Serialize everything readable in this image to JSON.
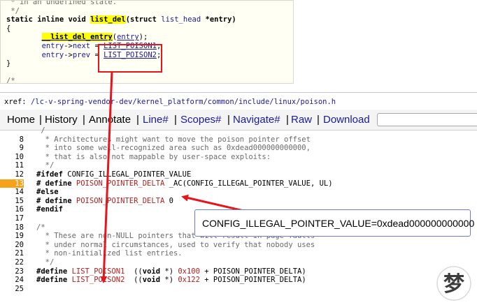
{
  "snippet": {
    "lines": [
      [
        {
          "c": "gr",
          "t": " * in an undefined state."
        }
      ],
      [
        {
          "c": "gr",
          "t": " */"
        }
      ],
      [
        {
          "c": "kw",
          "t": "static inline void "
        },
        {
          "c": "fn",
          "t": "list_del"
        },
        {
          "c": "kw",
          "t": "(struct "
        },
        {
          "c": "ty",
          "t": "list_head"
        },
        {
          "c": "kw",
          "t": " *entry)"
        }
      ],
      [
        {
          "c": "",
          "t": "{"
        }
      ],
      [
        {
          "c": "",
          "t": "        "
        },
        {
          "c": "fnu",
          "t": "__list_del_entry"
        },
        {
          "c": "",
          "t": "("
        },
        {
          "c": "argu",
          "t": "entry"
        },
        {
          "c": "",
          "t": ");"
        }
      ],
      [
        {
          "c": "",
          "t": "        "
        },
        {
          "c": "ty",
          "t": "entry"
        },
        {
          "c": "",
          "t": "->"
        },
        {
          "c": "ty",
          "t": "next"
        },
        {
          "c": "",
          "t": " = "
        },
        {
          "c": "mac",
          "t": "LIST_POISON1"
        },
        {
          "c": "",
          "t": ";"
        }
      ],
      [
        {
          "c": "",
          "t": "        "
        },
        {
          "c": "ty",
          "t": "entry"
        },
        {
          "c": "",
          "t": "->"
        },
        {
          "c": "ty",
          "t": "prev"
        },
        {
          "c": "",
          "t": " = "
        },
        {
          "c": "mac",
          "t": "LIST_POISON2"
        },
        {
          "c": "",
          "t": ";"
        }
      ],
      [
        {
          "c": "",
          "t": "}"
        }
      ],
      [
        {
          "c": "gr",
          "t": ""
        }
      ],
      [
        {
          "c": "gr",
          "t": "/*"
        }
      ]
    ]
  },
  "xref": {
    "prefix": "xref: ",
    "path": "/lc-v-spring-vendor-dev/kernel_platform/common/include/linux/poison.h"
  },
  "toolbar": {
    "home": "Home",
    "history": "History",
    "annotate": "Annotate",
    "line": "Line#",
    "scopes": "Scopes#",
    "navigate": "Navigate#",
    "raw": "Raw",
    "download": "Download",
    "sep": "|"
  },
  "code": {
    "highlighted_line": "13",
    "lines": [
      {
        "n": "",
        "parts": [
          {
            "c": "cmt",
            "t": " /"
          }
        ]
      },
      {
        "n": "8",
        "parts": [
          {
            "c": "cmt",
            "t": "  * Architectures might want to move the poison pointer offset"
          }
        ]
      },
      {
        "n": "9",
        "parts": [
          {
            "c": "cmt",
            "t": "  * into some well-recognized area such as 0xdead000000000000,"
          }
        ]
      },
      {
        "n": "10",
        "parts": [
          {
            "c": "cmt",
            "t": "  * that is also not mappable by user-space exploits:"
          }
        ]
      },
      {
        "n": "11",
        "parts": [
          {
            "c": "cmt",
            "t": "  */"
          }
        ]
      },
      {
        "n": "12",
        "parts": [
          {
            "c": "pp",
            "t": "#ifdef"
          },
          {
            "c": "",
            "t": " CONFIG_ILLEGAL_POINTER_VALUE"
          }
        ]
      },
      {
        "n": "13",
        "parts": [
          {
            "c": "pp",
            "t": "# define"
          },
          {
            "c": "",
            "t": " "
          },
          {
            "c": "rmac",
            "t": "POISON_POINTER_DELTA"
          },
          {
            "c": "",
            "t": " _AC(CONFIG_ILLEGAL_POINTER_VALUE, UL)"
          }
        ]
      },
      {
        "n": "14",
        "parts": [
          {
            "c": "pp",
            "t": "#else"
          }
        ]
      },
      {
        "n": "15",
        "parts": [
          {
            "c": "pp",
            "t": "# define"
          },
          {
            "c": "",
            "t": " "
          },
          {
            "c": "rmac",
            "t": "POISON_POINTER_DELTA"
          },
          {
            "c": "",
            "t": " 0"
          }
        ]
      },
      {
        "n": "16",
        "parts": [
          {
            "c": "pp",
            "t": "#endif"
          }
        ]
      },
      {
        "n": "17",
        "parts": [
          {
            "c": "",
            "t": ""
          }
        ]
      },
      {
        "n": "18",
        "parts": [
          {
            "c": "cmt",
            "t": "/*"
          }
        ]
      },
      {
        "n": "19",
        "parts": [
          {
            "c": "cmt",
            "t": "  * These are non-NULL pointers that will result in page faults"
          }
        ]
      },
      {
        "n": "20",
        "parts": [
          {
            "c": "cmt",
            "t": "  * under normal circumstances, used to verify that nobody uses"
          }
        ]
      },
      {
        "n": "21",
        "parts": [
          {
            "c": "cmt",
            "t": "  * non-initialized list entries."
          }
        ]
      },
      {
        "n": "22",
        "parts": [
          {
            "c": "cmt",
            "t": "  */"
          }
        ]
      },
      {
        "n": "23",
        "parts": [
          {
            "c": "pp",
            "t": "#define"
          },
          {
            "c": "",
            "t": " "
          },
          {
            "c": "rmac",
            "t": "LIST_POISON1"
          },
          {
            "c": "",
            "t": "  (("
          },
          {
            "c": "pp",
            "t": "void"
          },
          {
            "c": "",
            "t": " *) "
          },
          {
            "c": "hex",
            "t": "0x100"
          },
          {
            "c": "",
            "t": " + POISON_POINTER_DELTA)"
          }
        ]
      },
      {
        "n": "24",
        "parts": [
          {
            "c": "pp",
            "t": "#define"
          },
          {
            "c": "",
            "t": " "
          },
          {
            "c": "rmac",
            "t": "LIST_POISON2"
          },
          {
            "c": "",
            "t": "  (("
          },
          {
            "c": "pp",
            "t": "void"
          },
          {
            "c": "",
            "t": " *) "
          },
          {
            "c": "hex",
            "t": "0x122"
          },
          {
            "c": "",
            "t": " + POISON_POINTER_DELTA)"
          }
        ]
      },
      {
        "n": "25",
        "parts": [
          {
            "c": "",
            "t": ""
          }
        ]
      }
    ]
  },
  "callout": {
    "text": "CONFIG_ILLEGAL_POINTER_VALUE=0xdead000000000000"
  },
  "colors": {
    "arrow": "#e8141c",
    "highlight": "#f7a21b",
    "link": "#1a1a9a",
    "macro": "#b22222"
  },
  "watermark": {
    "icon": "logo-seal-icon",
    "glyphs": "梦"
  }
}
